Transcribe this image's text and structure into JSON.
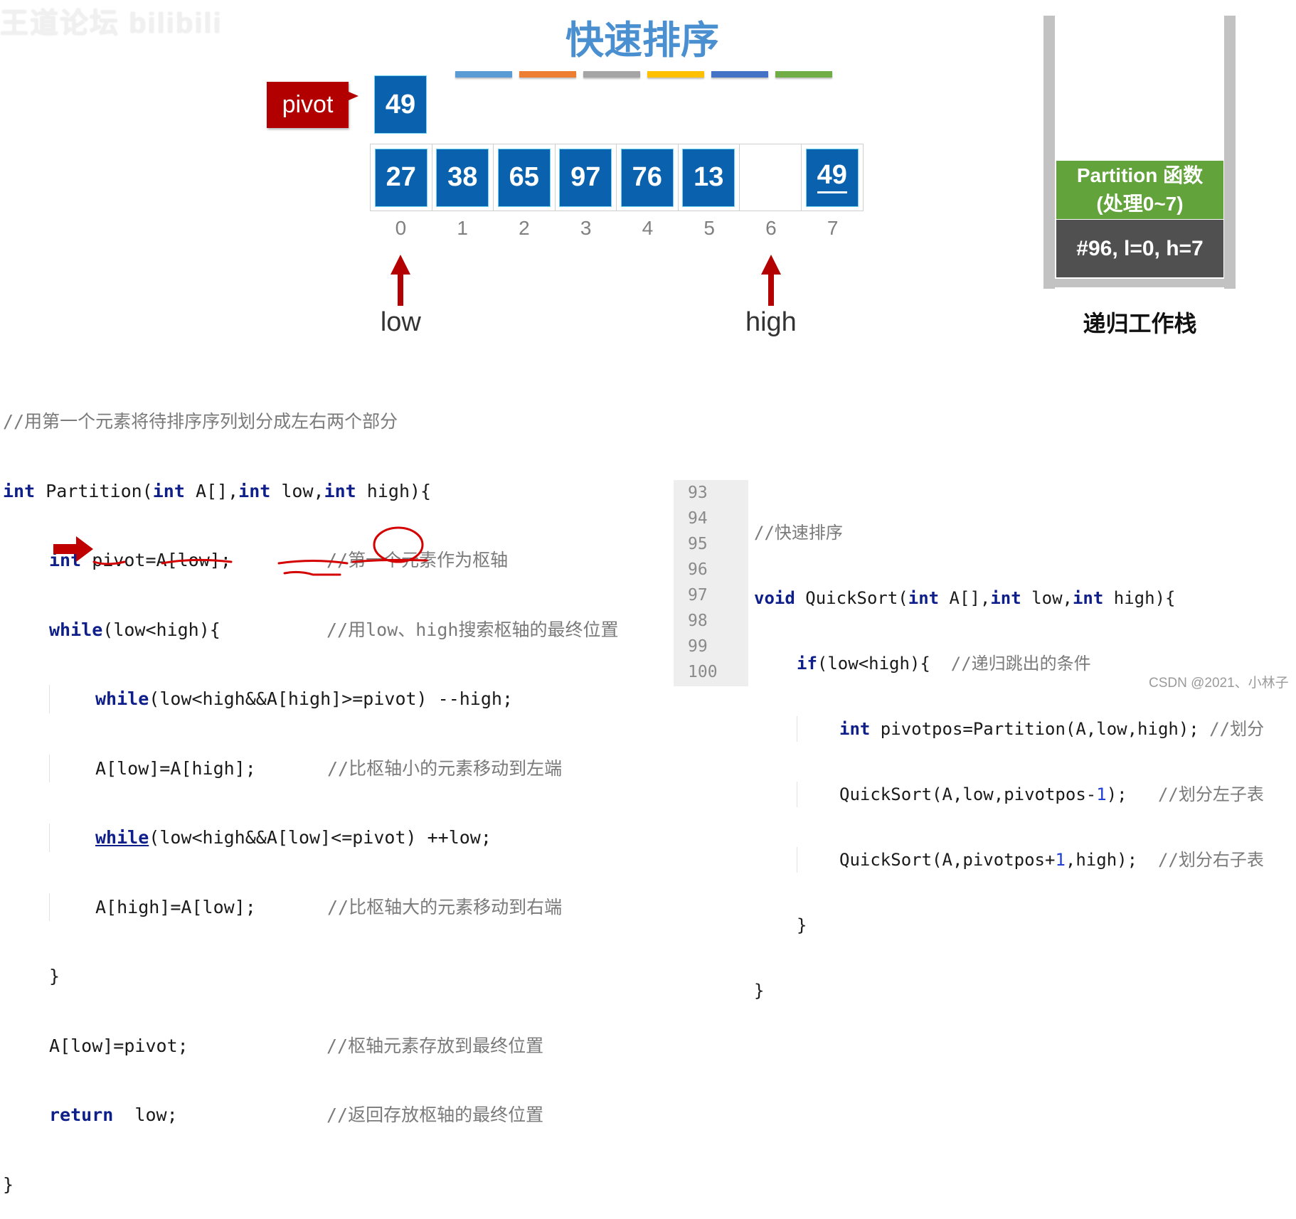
{
  "watermark": "王道论坛 bilibili",
  "title": "快速排序",
  "color_bars": [
    "#5b9bd5",
    "#ed7d31",
    "#a5a5a5",
    "#ffc000",
    "#4472c4",
    "#70ad47"
  ],
  "pivot": {
    "label": "pivot",
    "value": "49"
  },
  "array": {
    "cells": [
      {
        "index": "0",
        "value": "27"
      },
      {
        "index": "1",
        "value": "38"
      },
      {
        "index": "2",
        "value": "65"
      },
      {
        "index": "3",
        "value": "97"
      },
      {
        "index": "4",
        "value": "76"
      },
      {
        "index": "5",
        "value": "13"
      },
      {
        "index": "6",
        "value": ""
      },
      {
        "index": "7",
        "value": "49"
      }
    ]
  },
  "pointers": {
    "low": {
      "label": "low",
      "index": 0
    },
    "high": {
      "label": "high",
      "index": 6
    }
  },
  "stack": {
    "caption": "递归工作栈",
    "frames": [
      {
        "line1": "Partition 函数",
        "line2": "(处理0~7)"
      },
      {
        "text": "#96, l=0, h=7"
      }
    ]
  },
  "partition_code": {
    "header_comment": "//用第一个元素将待排序序列划分成左右两个部分",
    "lines": [
      {
        "kw": "int",
        "code": " Partition(",
        "kw2": "int",
        "code2": " A[],",
        "kw3": "int",
        "code3": " low,",
        "kw4": "int",
        "code4": " high){"
      },
      {
        "kw": "int",
        "code": " pivot=A[low];",
        "comment": "//第一个元素作为枢轴"
      },
      {
        "kw": "while",
        "code": "(low<high){",
        "comment": "//用low、high搜索枢轴的最终位置"
      },
      {
        "kw": "while",
        "code": "(low<high&&A[high]>=pivot) --high;"
      },
      {
        "code": "A[low]=A[high];",
        "comment": "//比枢轴小的元素移动到左端"
      },
      {
        "kw": "while",
        "code": "(low<high&&A[low]<=pivot) ++low;"
      },
      {
        "code": "A[high]=A[low];",
        "comment": "//比枢轴大的元素移动到右端"
      },
      {
        "code": "}"
      },
      {
        "code": "A[low]=pivot;",
        "comment": "//枢轴元素存放到最终位置"
      },
      {
        "kw": "return",
        "code": "  low;",
        "comment": "//返回存放枢轴的最终位置"
      },
      {
        "code": "}"
      }
    ]
  },
  "quicksort_code": {
    "line_numbers": [
      "93",
      "94",
      "95",
      "96",
      "97",
      "98",
      "99",
      "100"
    ],
    "lines": [
      {
        "comment": "//快速排序"
      },
      {
        "kw": "void",
        "code": " QuickSort(",
        "kw2": "int",
        "code2": " A[],",
        "kw3": "int",
        "code3": " low,",
        "kw4": "int",
        "code4": " high){"
      },
      {
        "kw": "if",
        "code": "(low<high){  ",
        "comment": "//递归跳出的条件"
      },
      {
        "kw": "int",
        "code": " pivotpos=Partition(A,low,high);",
        "comment": " //划分"
      },
      {
        "code": "QuickSort(A,low,pivotpos-",
        "num": "1",
        "code2": ");",
        "comment": "   //划分左子表"
      },
      {
        "code": "QuickSort(A,pivotpos+",
        "num": "1",
        "code2": ",high);",
        "comment": "  //划分右子表"
      },
      {
        "code": "}"
      },
      {
        "code": "}"
      }
    ]
  },
  "credit": "CSDN @2021、小林子"
}
